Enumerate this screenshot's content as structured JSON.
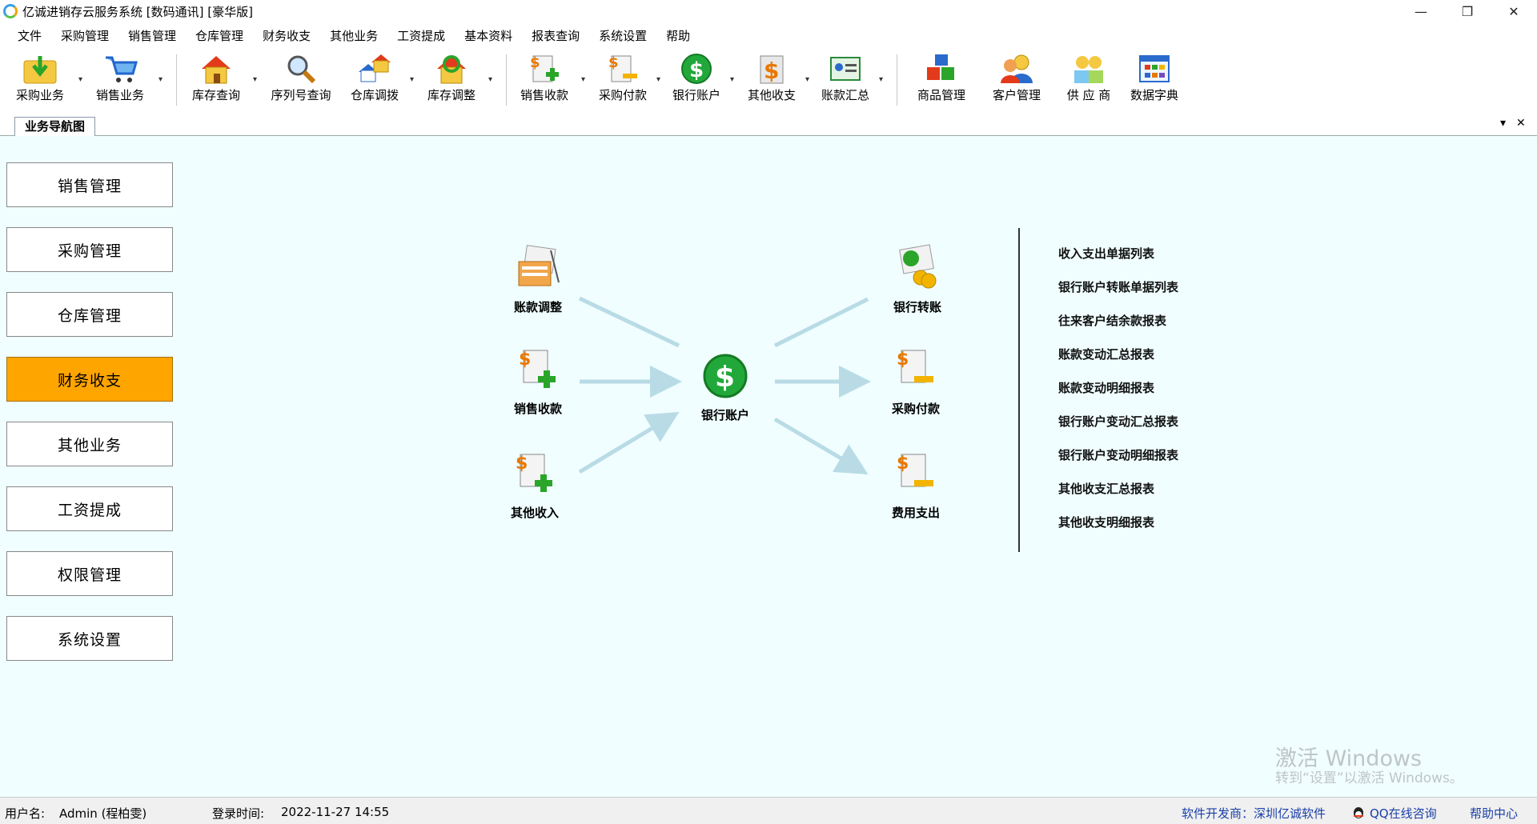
{
  "window": {
    "title": "亿诚进销存云服务系统 [数码通讯] [豪华版]",
    "controls": [
      "—",
      "❐",
      "✕"
    ]
  },
  "menu": [
    "文件",
    "采购管理",
    "销售管理",
    "仓库管理",
    "财务收支",
    "其他业务",
    "工资提成",
    "基本资料",
    "报表查询",
    "系统设置",
    "帮助"
  ],
  "toolbar": {
    "purchase": "采购业务",
    "sales": "销售业务",
    "stock_query": "库存查询",
    "serial_query": "序列号查询",
    "transfer": "仓库调拨",
    "stock_adjust": "库存调整",
    "sales_receipt": "销售收款",
    "purchase_payment": "采购付款",
    "bank_account": "银行账户",
    "other_income_expense": "其他收支",
    "account_summary": "账款汇总",
    "product_mgmt": "商品管理",
    "customer_mgmt": "客户管理",
    "supplier": "供 应 商",
    "data_dictionary": "数据字典"
  },
  "tab": {
    "label": "业务导航图",
    "dropdown": "▾",
    "close": "✕"
  },
  "nav": {
    "items": [
      "销售管理",
      "采购管理",
      "仓库管理",
      "财务收支",
      "其他业务",
      "工资提成",
      "权限管理",
      "系统设置"
    ],
    "active_index": 3
  },
  "flow": {
    "account_adjust": "账款调整",
    "sales_receipt": "销售收款",
    "other_income": "其他收入",
    "bank_account": "银行账户",
    "bank_transfer": "银行转账",
    "purchase_payment": "采购付款",
    "expense": "费用支出"
  },
  "reports": [
    "收入支出单据列表",
    "银行账户转账单据列表",
    "往来客户结余款报表",
    "账款变动汇总报表",
    "账款变动明细报表",
    "银行账户变动汇总报表",
    "银行账户变动明细报表",
    "其他收支汇总报表",
    "其他收支明细报表"
  ],
  "watermark": {
    "line1": "激活 Windows",
    "line2": "转到“设置”以激活 Windows。"
  },
  "status": {
    "user_label": "用户名:",
    "user_value": "Admin (程柏雯)",
    "login_label": "登录时间:",
    "login_value": "2022-11-27 14:55",
    "developer": "软件开发商：深圳亿诚软件",
    "qq": "QQ在线咨询",
    "help": "帮助中心"
  },
  "colors": {
    "active_nav": "#ffa500",
    "main_bg": "#f0feff",
    "arrow": "#b9dbe6",
    "link_blue": "#1a3fa8"
  }
}
